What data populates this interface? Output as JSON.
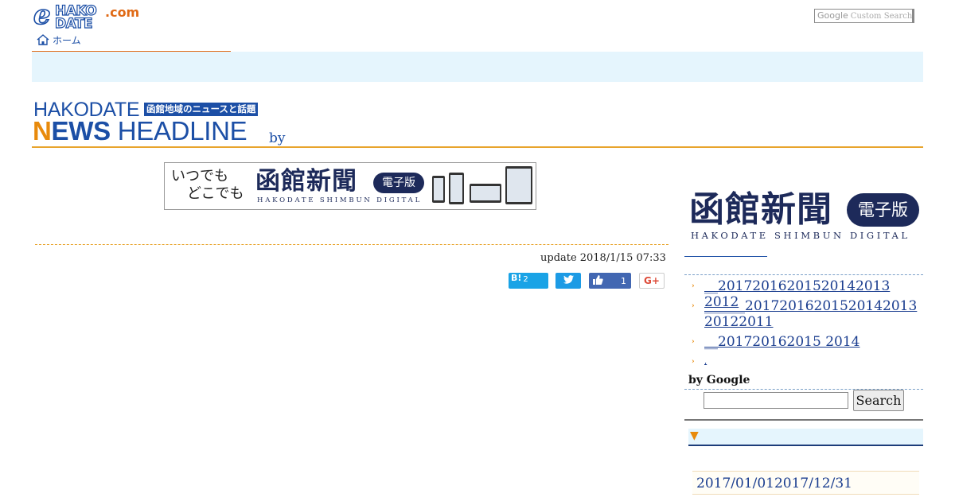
{
  "header": {
    "logo": {
      "e": "e",
      "hako": "HAKO",
      "date": "DATE",
      "com": ".com"
    },
    "home_label": "ホーム",
    "search": {
      "brand": "Google",
      "placeholder": "Custom Search"
    }
  },
  "title_block": {
    "hakodate": "HAKODATE",
    "tagline": "函館地域のニュースと話題",
    "news_n": "N",
    "news_rest": "EWS",
    "headline": "HEADLINE",
    "by": "by"
  },
  "main_ad": {
    "line1": "いつでも",
    "line2": "どこでも",
    "brand": "函館新聞",
    "pill": "電子版",
    "sub": "HAKODATE SHIMBUN DIGITAL"
  },
  "article": {
    "update_label": "update",
    "update_time": "2018/1/15 07:33"
  },
  "share": {
    "hatena_label": "B!",
    "hatena_count": "2",
    "like_count": "1",
    "gplus_label": "G+"
  },
  "sidebar": {
    "logo": {
      "brand": "函館新聞",
      "pill": "電子版",
      "sub": "HAKODATE SHIMBUN DIGITAL"
    },
    "links": [
      {
        "text": "__20172016201520142013 2012"
      },
      {
        "text": "______20172016201520142013 20122011"
      },
      {
        "text": "__201720162015 2014"
      },
      {
        "text": ","
      }
    ],
    "google_label": "by Google",
    "search_button": "Search",
    "archive_item": "2017/01/012017/12/31"
  },
  "colors": {
    "brand_blue": "#1c4fa6",
    "accent_orange": "#e88a0c",
    "strip_blue": "#e5f5fd",
    "navy": "#1d2a5a"
  }
}
